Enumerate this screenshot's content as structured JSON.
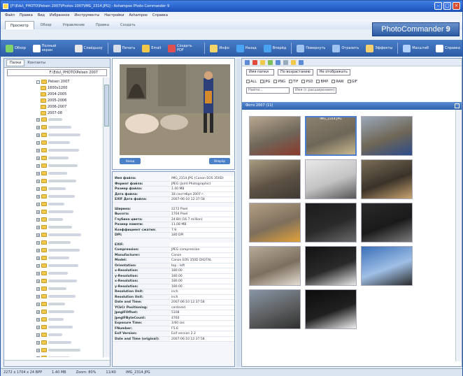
{
  "window": {
    "title": "[F:\\Edu\\_PHOTO\\Pelsen 2007\\Photos 2007\\IMG_2314.JPG] - Ashampoo Photo Commander 9"
  },
  "brand": {
    "name": "PhotoCommander",
    "version": "9"
  },
  "menu": [
    "Файл",
    "Правка",
    "Вид",
    "Избранное",
    "Инструменты",
    "Настройки",
    "Ashampoo",
    "Справка"
  ],
  "tabs": [
    "Просмотр",
    "Обзор",
    "Управление",
    "Правка",
    "Создать"
  ],
  "toolbar": [
    {
      "label": "Обзор",
      "icon": "browse-icon",
      "color": "#7fd36a"
    },
    {
      "label": "Полный экран",
      "icon": "fullscreen-icon",
      "color": "#ffffff"
    },
    {
      "label": "Слайдшоу",
      "icon": "slideshow-icon",
      "color": "#e8e8e8"
    },
    {
      "label": "Печать",
      "icon": "print-icon",
      "color": "#d6dde8"
    },
    {
      "label": "Email",
      "icon": "email-icon",
      "color": "#f1c84a"
    },
    {
      "label": "Создать PDF",
      "icon": "pdf-icon",
      "color": "#e05050"
    },
    {
      "label": "Инфо",
      "icon": "info-icon",
      "color": "#f4d56a"
    },
    {
      "label": "Назад",
      "icon": "back-icon",
      "color": "#49a3f2"
    },
    {
      "label": "Вперёд",
      "icon": "forward-icon",
      "color": "#49a3f2"
    },
    {
      "label": "Повернуть",
      "icon": "rotate-icon",
      "color": "#9ec3f0"
    },
    {
      "label": "Отразить",
      "icon": "flip-icon",
      "color": "#9ec3f0"
    },
    {
      "label": "Эффекты",
      "icon": "effects-icon",
      "color": "#f5d070"
    },
    {
      "label": "Масштаб",
      "icon": "zoom-icon",
      "color": "#b0d0ff"
    },
    {
      "label": "Справка",
      "icon": "help-icon",
      "color": "#ffffff"
    }
  ],
  "left": {
    "tab1": "Папки",
    "tab2": "Контакты",
    "path": "F:\\Edu\\_PHOTO\\Pelsen 2007",
    "folders": [
      "Pelsen 2007",
      "1600x1200",
      "2004-2005",
      "2005-2006",
      "2006-2007",
      "2007-08",
      "Photos 2007",
      "IMG_2314"
    ]
  },
  "preview": {
    "prev": "Назад",
    "next": "Вперёд"
  },
  "props": {
    "group1": [
      [
        "Имя файла:",
        "IMG_2314.JPG (Canon EOS 350D)"
      ],
      [
        "Формат файла:",
        "JPEG (Joint Photographic)"
      ],
      [
        "Размер файла:",
        "1.40 MB"
      ],
      [
        "Дата файла:",
        "18 сентября 2007 г."
      ],
      [
        "EXIF Дата файла:",
        "2007-06-10 12:37:58"
      ]
    ],
    "group2": [
      [
        "Ширина:",
        "2272 Pixel"
      ],
      [
        "Высота:",
        "1704 Pixel"
      ],
      [
        "Глубина цвета:",
        "24 Bit (16.7 million)"
      ],
      [
        "Размер памяти:",
        "11.08 MB"
      ],
      [
        "Коэффициент сжатия:",
        "7.9"
      ],
      [
        "DPI:",
        "180 DPI"
      ]
    ],
    "group3": [
      [
        "EXIF:",
        ""
      ],
      [
        "Compression:",
        "JPEG compression"
      ],
      [
        "Manufacturer:",
        "Canon"
      ],
      [
        "Model:",
        "Canon EOS 350D DIGITAL"
      ],
      [
        "Orientation:",
        "top - left"
      ],
      [
        "x-Resolution:",
        "180.00"
      ],
      [
        "y-Resolution:",
        "180.00"
      ],
      [
        "x-Resolution:",
        "180.00"
      ],
      [
        "y-Resolution:",
        "180.00"
      ],
      [
        "Resolution Unit:",
        "inch"
      ],
      [
        "Resolution Unit:",
        "inch"
      ],
      [
        "Date and Time:",
        "2007:06:10 12:37:58"
      ],
      [
        "YCbCr Positioning:",
        "centered"
      ],
      [
        "JpegIFOffset:",
        "5108"
      ],
      [
        "JpegIFByteCount:",
        "4760"
      ],
      [
        "Exposure Time:",
        "1/60 sec"
      ],
      [
        "FNumber:",
        "F5.6"
      ],
      [
        "Exif Version:",
        "Exif version 2.2"
      ],
      [
        "Date and Time (original):",
        "2007:06:10 12:37:58"
      ]
    ]
  },
  "filter": {
    "sort": "Имя папки",
    "order": "По возрастанию",
    "show": "Не отображать",
    "exts": [
      "ALL",
      "JPG",
      "PNG",
      "TIF",
      "PSD",
      "BMP",
      "RAW",
      "GIF"
    ],
    "search": "Найти...",
    "filename": "Имя (с расширением)"
  },
  "gallery": {
    "header": "Фото 2007 (11)",
    "thumbs": [
      {
        "label": "",
        "colors": [
          "#b8a890",
          "#6f665a",
          "#8b3a2a"
        ]
      },
      {
        "label": "IMG_2314.JPG",
        "colors": [
          "#8d8270",
          "#6e6658",
          "#c9b98f"
        ]
      },
      {
        "label": "",
        "colors": [
          "#9aa8b8",
          "#6f6656",
          "#2c4c8a"
        ]
      },
      {
        "label": "",
        "colors": [
          "#a79b80",
          "#5e5245",
          "#3f3a33"
        ]
      },
      {
        "label": "",
        "colors": [
          "#e9e9ea",
          "#c3c3c4",
          "#565656"
        ]
      },
      {
        "label": "",
        "colors": [
          "#7a6d58",
          "#3a3229",
          "#c9a470"
        ]
      },
      {
        "label": "",
        "colors": [
          "#b49f86",
          "#7e6f5c",
          "#e3a23a"
        ]
      },
      {
        "label": "",
        "colors": [
          "#1c1c1c",
          "#2a2a2a",
          "#6a6a6a"
        ]
      },
      {
        "label": "",
        "colors": [
          "#2a2a2a",
          "#1a1a1a",
          "#7c7c7c"
        ]
      },
      {
        "label": "",
        "colors": [
          "#b7aa97",
          "#7c6f5f",
          "#e7dfd4"
        ]
      },
      {
        "label": "",
        "colors": [
          "#121212",
          "#2a2a2a",
          "#e9e9e9"
        ]
      },
      {
        "label": "",
        "colors": [
          "#3a6fb8",
          "#9fbfe6",
          "#2a2a2a"
        ]
      },
      {
        "label": "",
        "colors": [
          "#8896a6",
          "#5d5f60",
          "#2f2f2f"
        ]
      },
      {
        "label": "",
        "colors": [
          "#0c0c0c",
          "#202020",
          "#f0f0f0"
        ]
      }
    ]
  },
  "status": [
    "2272 x 1704 x 24 BPP",
    "1.40 MB",
    "Zoom: 80%",
    "11/40",
    "IMG_2314.JPG"
  ]
}
